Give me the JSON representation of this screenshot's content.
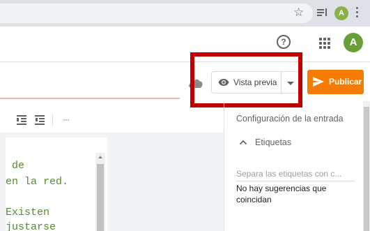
{
  "browser": {
    "star_icon": "star-outline-icon",
    "media_icon": "media-control-icon",
    "profile_initial": "A",
    "menu_icon": "vertical-dots-icon"
  },
  "header": {
    "help_icon": "help-circle-icon",
    "apps_icon": "apps-grid-icon",
    "account_initial": "A",
    "avatar_color": "#689f38"
  },
  "actions": {
    "cloud_icon": "cloud-saved-icon",
    "preview_label": "Vista previa",
    "preview_icon": "eye-icon",
    "preview_dropdown_icon": "caret-down-icon",
    "publish_label": "Publicar",
    "publish_icon": "send-icon",
    "publish_color": "#f57c00",
    "highlight_color": "#c00000"
  },
  "toolbar": {
    "indent_increase_icon": "indent-increase-icon",
    "indent_decrease_icon": "indent-decrease-icon",
    "more_label": "···"
  },
  "editor": {
    "lines": [
      " de",
      "en la red.",
      "",
      "Existen",
      "justarse"
    ],
    "text_color": "#558b2f"
  },
  "sidebar": {
    "settings_title": "Configuración de la entrada",
    "labels_section": "Etiquetas",
    "labels_placeholder": "Separa las etiquetas con c...",
    "no_suggestions_line1": "No hay sugerencias que",
    "no_suggestions_line2": "coincidan"
  }
}
